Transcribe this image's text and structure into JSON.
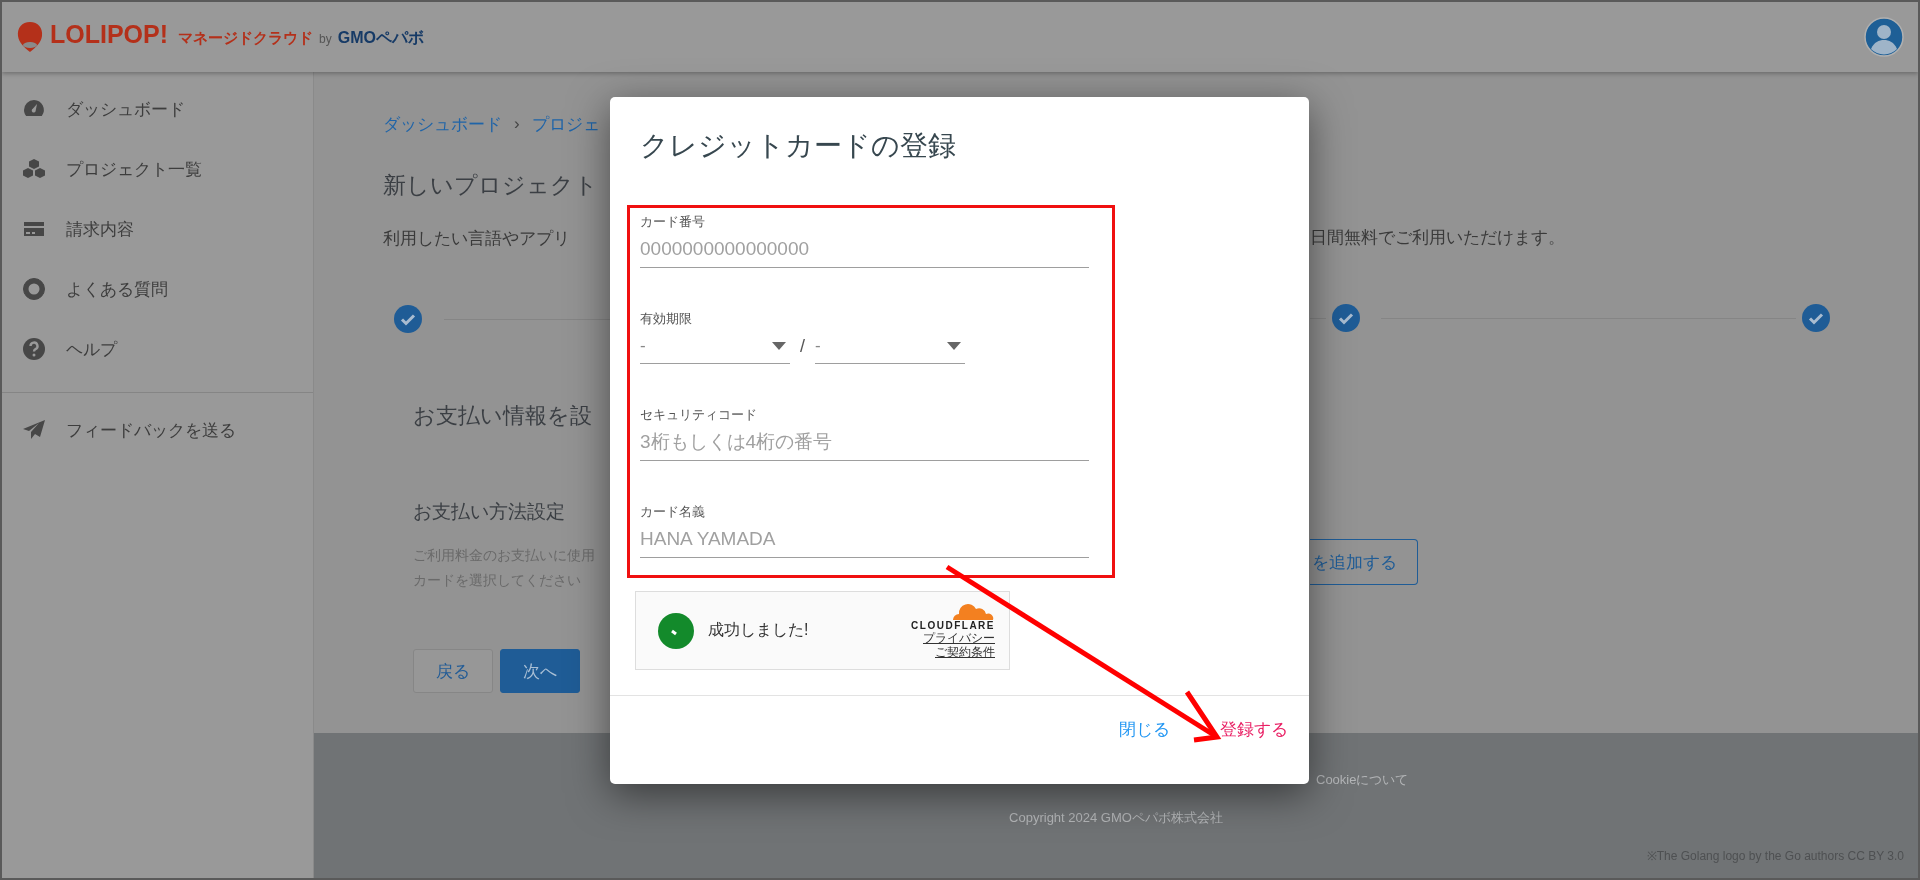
{
  "header": {
    "logo": {
      "brand": "LOLIPOP!",
      "product": "マネージドクラウド",
      "by": "by",
      "company": "GMOペパボ"
    }
  },
  "sidebar": {
    "items": [
      {
        "label": "ダッシュボード"
      },
      {
        "label": "プロジェクト一覧"
      },
      {
        "label": "請求内容"
      },
      {
        "label": "よくある質問"
      },
      {
        "label": "ヘルプ"
      }
    ],
    "feedback": {
      "label": "フィードバックを送る"
    }
  },
  "page": {
    "breadcrumb": [
      "ダッシュボード",
      "プロジェ"
    ],
    "breadcrumb_separator": "›",
    "heading": "新しいプロジェクト",
    "intro_left": "利用したい言語やアプリ",
    "intro_right": "日間無料でご利用いただけます。",
    "steps_left": [
      {
        "done": true
      }
    ],
    "steps_right": [
      {
        "done": true
      },
      {
        "done": true
      }
    ],
    "section_title": "お支払い情報を設",
    "payment": {
      "title": "お支払い方法設定",
      "description_lines": [
        "ご利用料金のお支払いに使用",
        "カードを選択してください"
      ],
      "add_button": "を追加する"
    },
    "buttons": [
      {
        "label": "戻る",
        "kind": "secondary"
      },
      {
        "label": "次へ",
        "kind": "primary"
      }
    ]
  },
  "footer": {
    "links": [
      "Cookieについて"
    ],
    "copyright": "Copyright 2024 GMOペパボ株式会社",
    "note": "※The Golang logo by the Go authors CC BY 3.0"
  },
  "dialog": {
    "title": "クレジットカードの登録",
    "fields": [
      {
        "kind": "text",
        "label": "カード番号",
        "placeholder": "0000000000000000"
      },
      {
        "kind": "expiry",
        "label": "有効期限",
        "month": "-",
        "separator": "/",
        "year": "-"
      },
      {
        "kind": "text",
        "label": "セキュリティコード",
        "placeholder": "3桁もしくは4桁の番号"
      },
      {
        "kind": "text",
        "label": "カード名義",
        "placeholder": "HANA YAMADA"
      }
    ],
    "captcha": {
      "status": "成功しました!",
      "provider": "CLOUDFLARE",
      "links": [
        "プライバシー",
        "ご契約条件"
      ]
    },
    "actions": [
      {
        "label": "閉じる",
        "kind": "close"
      },
      {
        "label": "登録する",
        "kind": "submit"
      }
    ]
  },
  "annotations": [
    {
      "kind": "frame"
    },
    {
      "kind": "arrow"
    }
  ]
}
